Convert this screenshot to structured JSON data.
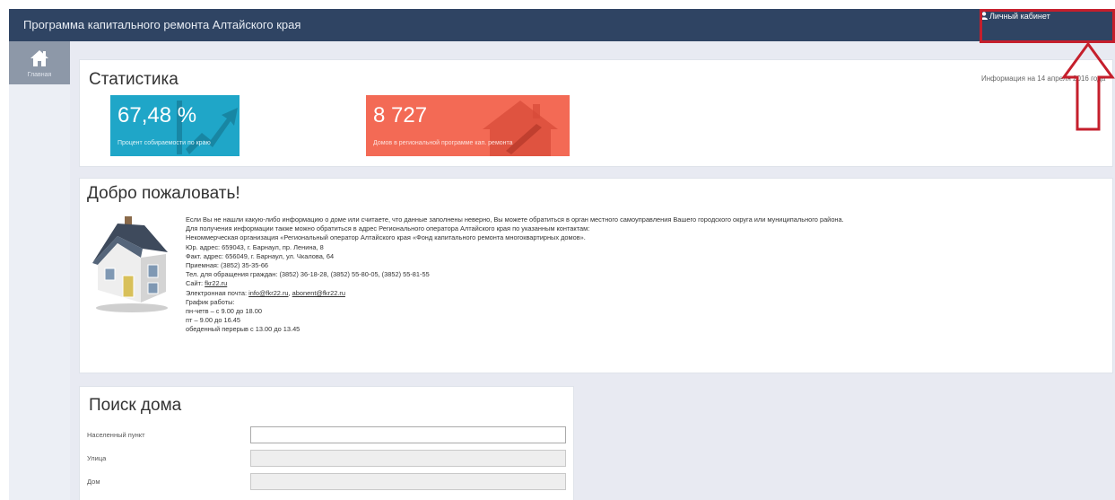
{
  "header": {
    "title": "Программа капитального ремонта Алтайского края",
    "cabinet_label": "Личный кабинет"
  },
  "sidebar": {
    "items": [
      {
        "label": "Главная",
        "icon": "home-icon"
      }
    ]
  },
  "stats": {
    "title": "Статистика",
    "info_date": "Информация на 14 апреля 2016 года",
    "tiles": [
      {
        "value": "67,48 %",
        "caption": "Процент собираемости по краю",
        "color": "#1fa6c8",
        "icon": "chart-up-icon"
      },
      {
        "value": "8 727",
        "caption": "Домов в региональной программе кап. ремонта",
        "color": "#f36a55",
        "icon": "house-wrench-icon"
      }
    ]
  },
  "welcome": {
    "title": "Добро пожаловать!",
    "lines": [
      "Если Вы не нашли какую-либо информацию о доме или считаете, что данные заполнены неверно, Вы можете обратиться в орган местного самоуправления Вашего городского округа или муниципального района.",
      "Для получения информации также можно обратиться в адрес Регионального оператора Алтайского края по указанным контактам:",
      "Некоммерческая организация «Региональный оператор Алтайского края «Фонд капитального ремонта многоквартирных домов».",
      "Юр. адрес: 659043, г. Барнаул, пр. Ленина, 8",
      "Факт. адрес: 656049, г. Барнаул, ул. Чкалова, 64",
      "Приемная: (3852) 35-35-66",
      "Тел. для обращения граждан: (3852) 36-18-28, (3852) 55-80-05, (3852) 55-81-55"
    ],
    "site_label": "Сайт: ",
    "site_link": "fkr22.ru",
    "email_label": "Электронная почта: ",
    "email_link1": "info@fkr22.ru",
    "email_sep": ", ",
    "email_link2": "abonent@fkr22.ru",
    "schedule": [
      "График работы:",
      "пн-четв – с 9.00 до 18.00",
      "пт – 9.00 до 16.45",
      "обеденный перерыв с 13.00 до 13.45"
    ]
  },
  "search": {
    "title": "Поиск дома",
    "fields": [
      {
        "label": "Населенный пункт",
        "value": "",
        "disabled": false
      },
      {
        "label": "Улица",
        "value": "",
        "disabled": true
      },
      {
        "label": "Дом",
        "value": "",
        "disabled": true
      }
    ]
  },
  "colors": {
    "header_bg": "#2f4463",
    "sidebar_active": "#8d98a8",
    "annotation_red": "#c51f2c"
  }
}
